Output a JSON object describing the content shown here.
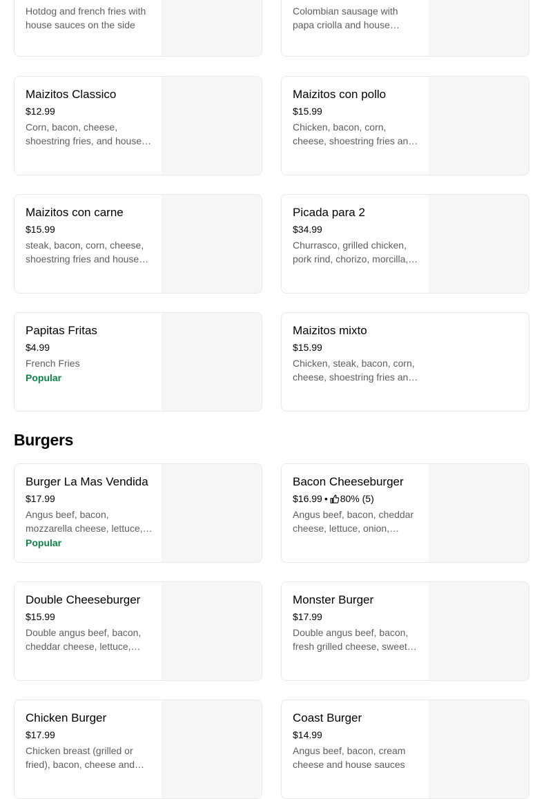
{
  "menu": {
    "top_items": [
      {
        "desc": "Hotdog and french fries with house sauces on the side"
      },
      {
        "desc": "Colombian sausage with papa criolla and house sauces"
      }
    ],
    "items_row1": [
      {
        "name": "Maizitos Classico",
        "price": "$12.99",
        "desc": "Corn, bacon, cheese, shoestring fries, and house sauces"
      },
      {
        "name": "Maizitos con pollo",
        "price": "$15.99",
        "desc": "Chicken, bacon, corn, cheese, shoestring fries and house sauces"
      }
    ],
    "items_row2": [
      {
        "name": "Maizitos con carne",
        "price": "$15.99",
        "desc": "steak, bacon, corn, cheese, shoestring fries and house sauces"
      },
      {
        "name": "Picada para 2",
        "price": "$34.99",
        "desc": "Churrasco, grilled chicken, pork rind, chorizo, morcilla, and more"
      }
    ],
    "items_row3": [
      {
        "name": "Papitas Fritas",
        "price": "$4.99",
        "desc": "French Fries",
        "badge": "Popular"
      },
      {
        "name": "Maizitos mixto",
        "price": "$15.99",
        "desc": "Chicken, steak, bacon, corn, cheese, shoestring fries and house sauces"
      }
    ]
  },
  "burgers": {
    "title": "Burgers",
    "row1": [
      {
        "name": "Burger La Mas Vendida",
        "price": "$17.99",
        "desc": "Angus beef, bacon, mozzarella cheese, lettuce, tomato and house sauces",
        "badge": "Popular"
      },
      {
        "name": "Bacon Cheeseburger",
        "price": "$16.99",
        "dot": "•",
        "rating": "80% (5)",
        "desc": "Angus beef, bacon, cheddar cheese, lettuce, onion, tomato and house sauces"
      }
    ],
    "row2": [
      {
        "name": "Double Cheeseburger",
        "price": "$15.99",
        "desc": "Double angus beef, bacon, cheddar cheese, lettuce, tomato and house sauces"
      },
      {
        "name": "Monster Burger",
        "price": "$17.99",
        "desc": "Double angus beef, bacon, fresh grilled cheese, sweet plantain and house sauces"
      }
    ],
    "row3": [
      {
        "name": "Chicken Burger",
        "price": "$17.99",
        "desc": "Chicken breast (grilled or fried), bacon, cheese and house sauces"
      },
      {
        "name": "Coast Burger",
        "price": "$14.99",
        "desc": "Angus beef, bacon, cream cheese and house sauces"
      }
    ]
  },
  "colors": {
    "accent_popular": "#0e8345",
    "image_placeholder": "#f6f6f6"
  },
  "icons": {
    "rating": "thumbs-up-icon"
  }
}
